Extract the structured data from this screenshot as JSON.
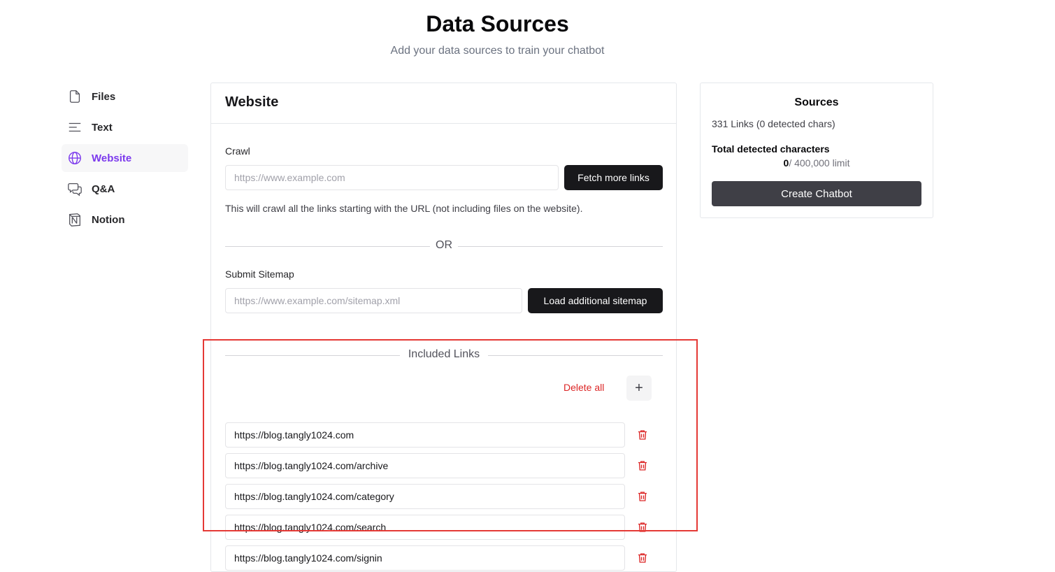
{
  "header": {
    "title": "Data Sources",
    "subtitle": "Add your data sources to train your chatbot"
  },
  "sidebar": {
    "items": [
      {
        "label": "Files",
        "icon": "file-icon",
        "active": false
      },
      {
        "label": "Text",
        "icon": "text-lines-icon",
        "active": false
      },
      {
        "label": "Website",
        "icon": "globe-icon",
        "active": true
      },
      {
        "label": "Q&A",
        "icon": "chat-bubbles-icon",
        "active": false
      },
      {
        "label": "Notion",
        "icon": "notion-icon",
        "active": false
      }
    ]
  },
  "website": {
    "title": "Website",
    "crawl": {
      "label": "Crawl",
      "placeholder": "https://www.example.com",
      "button": "Fetch more links",
      "hint": "This will crawl all the links starting with the URL (not including files on the website)."
    },
    "or_text": "OR",
    "sitemap": {
      "label": "Submit Sitemap",
      "placeholder": "https://www.example.com/sitemap.xml",
      "button": "Load additional sitemap"
    },
    "included": {
      "title": "Included Links",
      "delete_all": "Delete all",
      "add_symbol": "+",
      "links": [
        "https://blog.tangly1024.com",
        "https://blog.tangly1024.com/archive",
        "https://blog.tangly1024.com/category",
        "https://blog.tangly1024.com/search",
        "https://blog.tangly1024.com/signin"
      ]
    }
  },
  "sources": {
    "title": "Sources",
    "links_summary": "331 Links (0 detected chars)",
    "total_label": "Total detected characters",
    "total_value": "0",
    "limit_text": "/ 400,000 limit",
    "create_button": "Create Chatbot"
  },
  "colors": {
    "accent": "#7c3aed",
    "danger": "#dc2626",
    "highlight": "#e53935"
  }
}
